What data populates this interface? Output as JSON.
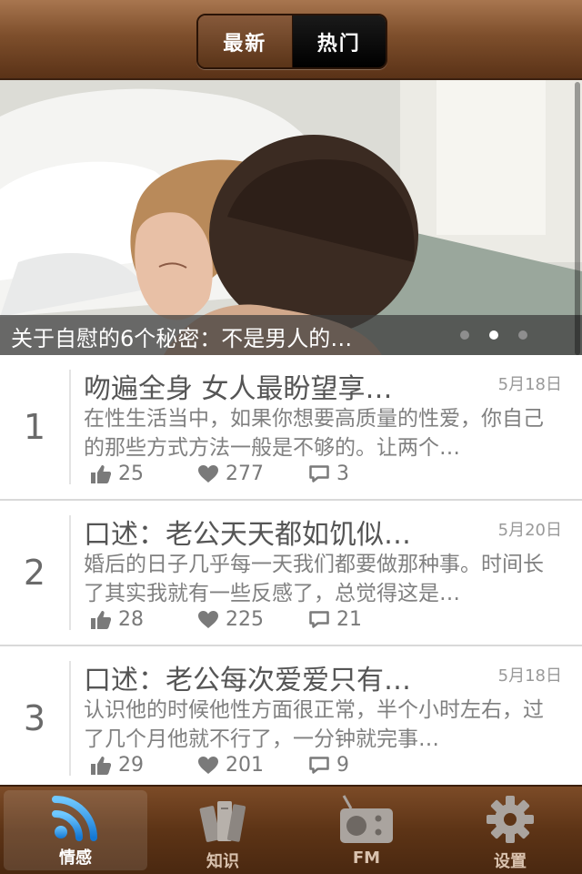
{
  "header": {
    "tabs": [
      {
        "label": "最新",
        "selected": false
      },
      {
        "label": "热门",
        "selected": true
      }
    ]
  },
  "banner": {
    "caption": "关于自慰的6个秘密：不是男人的…",
    "page_count": 3,
    "active_page": 2
  },
  "articles": [
    {
      "rank": "1",
      "title": "吻遍全身 女人最盼望享…",
      "date": "5月18日",
      "excerpt": "在性生活当中，如果你想要高质量的性爱，你自己的那些方式方法一般是不够的。让两个…",
      "likes": "25",
      "favorites": "277",
      "comments": "3"
    },
    {
      "rank": "2",
      "title": "口述：老公天天都如饥似…",
      "date": "5月20日",
      "excerpt": "婚后的日子几乎每一天我们都要做那种事。时间长了其实我就有一些反感了，总觉得这是…",
      "likes": "28",
      "favorites": "225",
      "comments": "21"
    },
    {
      "rank": "3",
      "title": "口述：老公每次爱爱只有…",
      "date": "5月18日",
      "excerpt": "认识他的时候他性方面很正常，半个小时左右，过了几个月他就不行了，一分钟就完事…",
      "likes": "29",
      "favorites": "201",
      "comments": "9"
    }
  ],
  "tabbar": {
    "items": [
      {
        "label": "情感",
        "icon": "rss-icon",
        "selected": true
      },
      {
        "label": "知识",
        "icon": "books-icon",
        "selected": false
      },
      {
        "label": "FM",
        "icon": "radio-icon",
        "selected": false
      },
      {
        "label": "设置",
        "icon": "gear-icon",
        "selected": false
      }
    ]
  },
  "colors": {
    "bar_brown": "#6b3e1e",
    "accent_blue": "#2a9df4"
  }
}
